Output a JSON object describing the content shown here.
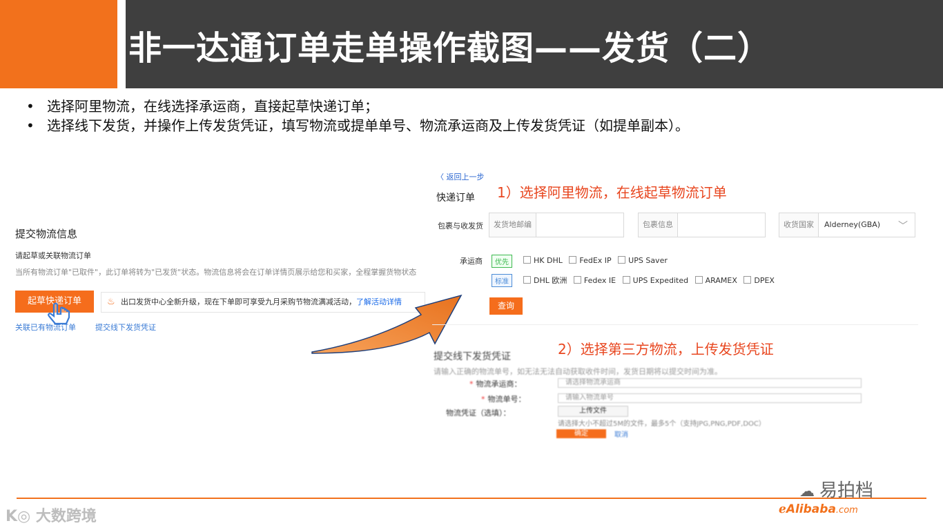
{
  "header": {
    "title": "非一达通订单走单操作截图——发货（二）"
  },
  "bullets": [
    "选择阿里物流，在线选择承运商，直接起草快递订单；",
    "选择线下发货，并操作上传发货凭证，填写物流或提单单号、物流承运商及上传发货凭证（如提单副本）。"
  ],
  "left_panel": {
    "title": "提交物流信息",
    "subtitle": "请起草或关联物流订单",
    "note": "当所有物流订单\"已取件\"，此订单将转为\"已发货\"状态。物流信息将会在订单详情页展示给您和买家，全程掌握货物状态",
    "draft_button": "起草快递订单",
    "notice_text": "出口发货中心全新升级，现在下单即可享受九月采购节物流满减活动，",
    "notice_link": "了解活动详情",
    "link_associate": "关联已有物流订单",
    "link_offline": "提交线下发货凭证"
  },
  "right_panel": {
    "back_link": "返回上一步",
    "title": "快递订单",
    "annotation1": "1）选择阿里物流，在线起草物流订单",
    "annotation2": "2）选择第三方物流，上传发货凭证",
    "row_label": "包裹与收发货",
    "field_origin": "发货地邮编",
    "field_package": "包裹信息",
    "field_country_label": "收货国家",
    "field_country_value": "Alderney(GBA)",
    "carrier_label": "承运商",
    "tag_priority": "优先",
    "tag_standard": "标准",
    "carriers_priority": [
      "HK DHL",
      "FedEx IP",
      "UPS Saver"
    ],
    "carriers_standard": [
      "DHL 欧洲",
      "Fedex IE",
      "UPS Expedited",
      "ARAMEX",
      "DPEX"
    ],
    "query_button": "查询"
  },
  "offline_form": {
    "title": "提交线下发货凭证",
    "note": "请输入正确的物流单号，如无法无法自动获取收件时间，发货日期将以提交时间为准。",
    "carrier_label": "物流承运商：",
    "carrier_placeholder": "请选择物流承运商",
    "tracking_label": "物流单号：",
    "tracking_placeholder": "请输入物流单号",
    "voucher_label": "物流凭证（选填）：",
    "upload_button": "上传文件",
    "upload_hint": "请选择大小不超过5M的文件，最多5个（支持JPG,PNG,PDF,DOC）",
    "ok_button": "确定",
    "cancel_link": "取消"
  },
  "footer": {
    "watermark_left": "大数跨境",
    "watermark_right": "易拍档",
    "alibaba_logo": "Alibaba",
    "alibaba_suffix": ".com"
  },
  "colors": {
    "accent_orange": "#f2711c",
    "header_dark": "#3f3f3f",
    "annotation_red": "#e8461f",
    "link_blue": "#3a7bd5"
  }
}
